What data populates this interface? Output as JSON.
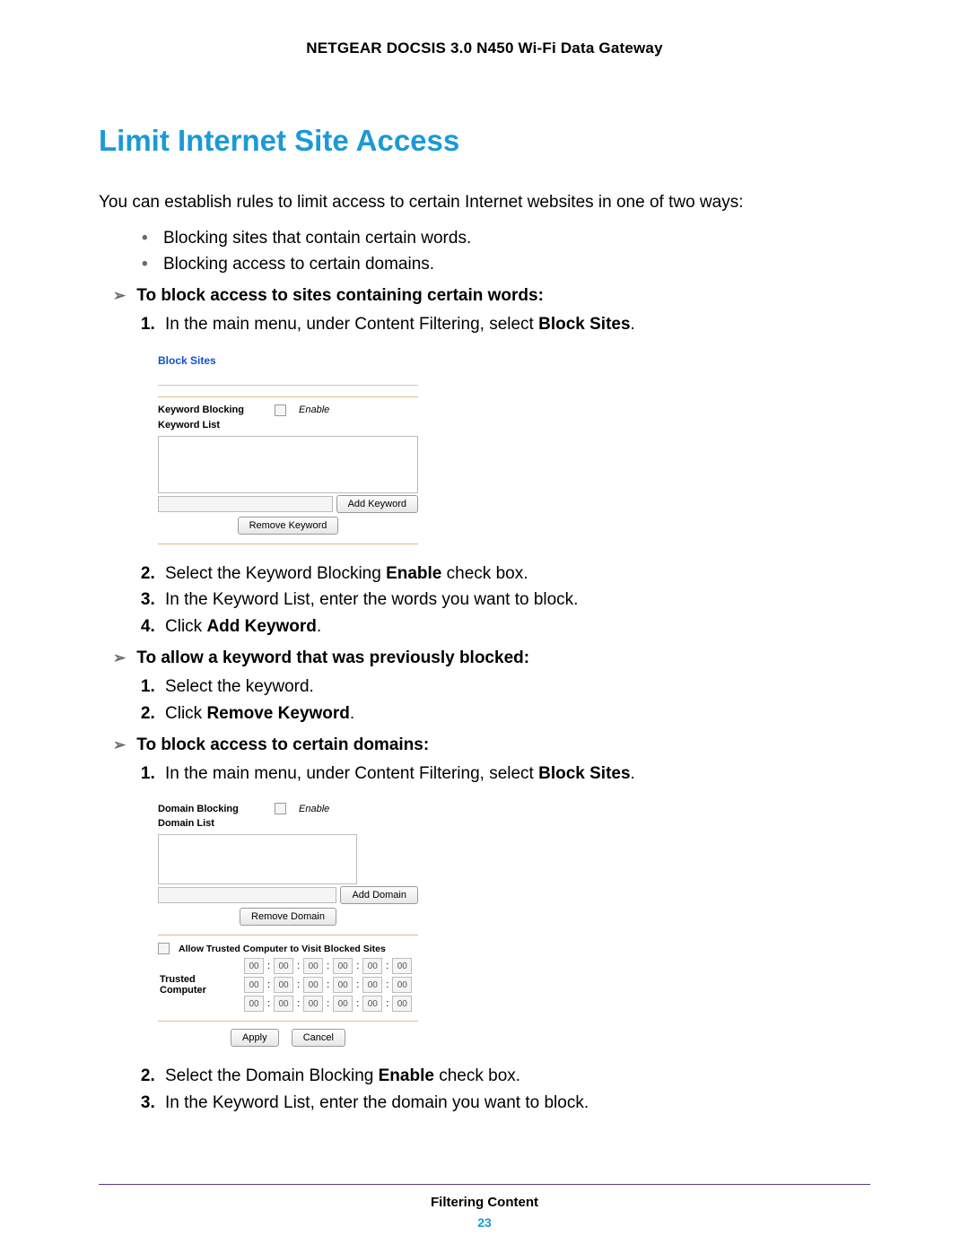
{
  "header": {
    "device_name": "NETGEAR DOCSIS 3.0 N450 Wi-Fi Data Gateway"
  },
  "section": {
    "title": "Limit Internet Site Access",
    "intro": "You can establish rules to limit access to certain Internet websites in one of two ways:",
    "methods": [
      "Blocking sites that contain certain words.",
      "Blocking access to certain domains."
    ],
    "proc1_title": "To block access to sites containing certain words:",
    "proc1_steps": {
      "s1_pre": "In the main menu, under Content Filtering, select ",
      "s1_bold": "Block Sites",
      "s2_pre": "Select the Keyword Blocking ",
      "s2_bold": "Enable",
      "s2_post": " check box.",
      "s3": "In the Keyword List, enter the words you want to block.",
      "s4_pre": "Click ",
      "s4_bold": "Add Keyword",
      "s4_post": "."
    },
    "proc2_title": "To allow a keyword that was previously blocked:",
    "proc2_steps": {
      "s1": "Select the keyword.",
      "s2_pre": "Click ",
      "s2_bold": "Remove Keyword",
      "s2_post": "."
    },
    "proc3_title": "To block access to certain domains:",
    "proc3_steps": {
      "s1_pre": "In the main menu, under Content Filtering, select ",
      "s1_bold": "Block Sites",
      "s2_pre": "Select the Domain Blocking ",
      "s2_bold": "Enable",
      "s2_post": " check box.",
      "s3": "In the Keyword List, enter the domain you want to block."
    }
  },
  "ui_block_sites": {
    "title": "Block Sites",
    "keyword_blocking": "Keyword Blocking",
    "enable": "Enable",
    "keyword_list": "Keyword List",
    "add_keyword": "Add Keyword",
    "remove_keyword": "Remove Keyword"
  },
  "ui_domain": {
    "domain_blocking": "Domain Blocking",
    "enable": "Enable",
    "domain_list": "Domain List",
    "add_domain": "Add Domain",
    "remove_domain": "Remove Domain",
    "allow_trusted": "Allow Trusted Computer to Visit Blocked Sites",
    "trusted_computer": "Trusted Computer",
    "mac": "00",
    "apply": "Apply",
    "cancel": "Cancel"
  },
  "footer": {
    "chapter": "Filtering Content",
    "page": "23"
  },
  "period": "."
}
